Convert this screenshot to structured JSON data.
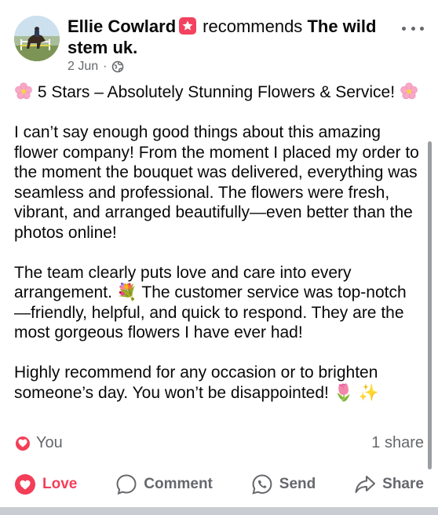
{
  "post": {
    "author": "Ellie Cowlard",
    "verb": "recommends",
    "page_name": "The wild stem uk.",
    "date": "2 Jun",
    "dot": "·",
    "title": "5 Stars – Absolutely Stunning Flowers & Service!",
    "paragraph1": "I can’t say enough good things about this amazing flower company! From the moment I placed my order to the moment the bouquet was delivered, everything was seamless and professional. The flowers were fresh, vibrant, and arranged beautifully—even better than the photos online!",
    "paragraph2_a": "The team clearly puts love and care into every arrangement.",
    "paragraph2_b": "The customer service was top-notch—friendly, helpful, and quick to respond. They are the most gorgeous flowers I have ever had!",
    "paragraph3": "Highly recommend for any occasion or to brighten someone’s day. You won’t be disappointed!",
    "emoji_bouquet": "💐",
    "emoji_tulip": "🌷",
    "emoji_sparkles": "✨"
  },
  "reactions": {
    "reactor": "You",
    "shares": "1 share"
  },
  "actions": {
    "love": "Love",
    "comment": "Comment",
    "send": "Send",
    "share": "Share"
  },
  "colors": {
    "love_red": "#f33e58",
    "recommend_badge": "#f3425f",
    "secondary_text": "#65676b"
  }
}
